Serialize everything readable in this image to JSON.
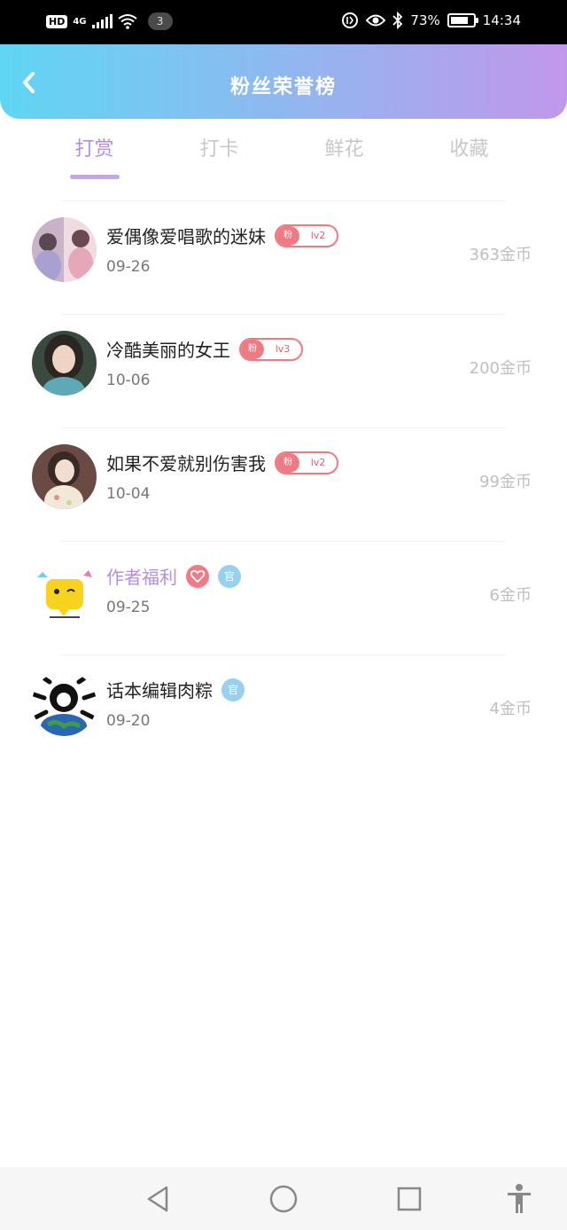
{
  "status_bar": {
    "hd": "HD",
    "network": "4G",
    "notification_count": "3",
    "battery": "73%",
    "time": "14:34"
  },
  "header": {
    "title": "粉丝荣誉榜"
  },
  "tabs": [
    {
      "label": "打赏",
      "active": true
    },
    {
      "label": "打卡",
      "active": false
    },
    {
      "label": "鲜花",
      "active": false
    },
    {
      "label": "收藏",
      "active": false
    }
  ],
  "entries": [
    {
      "name": "爱偶像爱唱歌的迷妹",
      "date": "09-26",
      "amount": "363金币",
      "badge_type": "fan",
      "badge_fan": "粉",
      "badge_level": "lv2"
    },
    {
      "name": "冷酷美丽的女王",
      "date": "10-06",
      "amount": "200金币",
      "badge_type": "fan",
      "badge_fan": "粉",
      "badge_level": "lv3"
    },
    {
      "name": "如果不爱就别伤害我",
      "date": "10-04",
      "amount": "99金币",
      "badge_type": "fan",
      "badge_fan": "粉",
      "badge_level": "lv2"
    },
    {
      "name": "作者福利",
      "date": "09-25",
      "amount": "6金币",
      "badge_type": "official-heart",
      "badge_official": "官"
    },
    {
      "name": "话本编辑肉粽",
      "date": "09-20",
      "amount": "4金币",
      "badge_type": "official",
      "badge_official": "官"
    }
  ],
  "icons": {
    "back": "chevron-left-icon",
    "nav": [
      "back-triangle-icon",
      "home-circle-icon",
      "recents-square-icon",
      "accessibility-icon"
    ]
  },
  "colors": {
    "header_gradient_start": "#5fd6f3",
    "header_gradient_end": "#c197ec",
    "tab_active": "#b48ee0",
    "badge_fan": "#f07a84",
    "badge_official": "#98d0ef"
  }
}
